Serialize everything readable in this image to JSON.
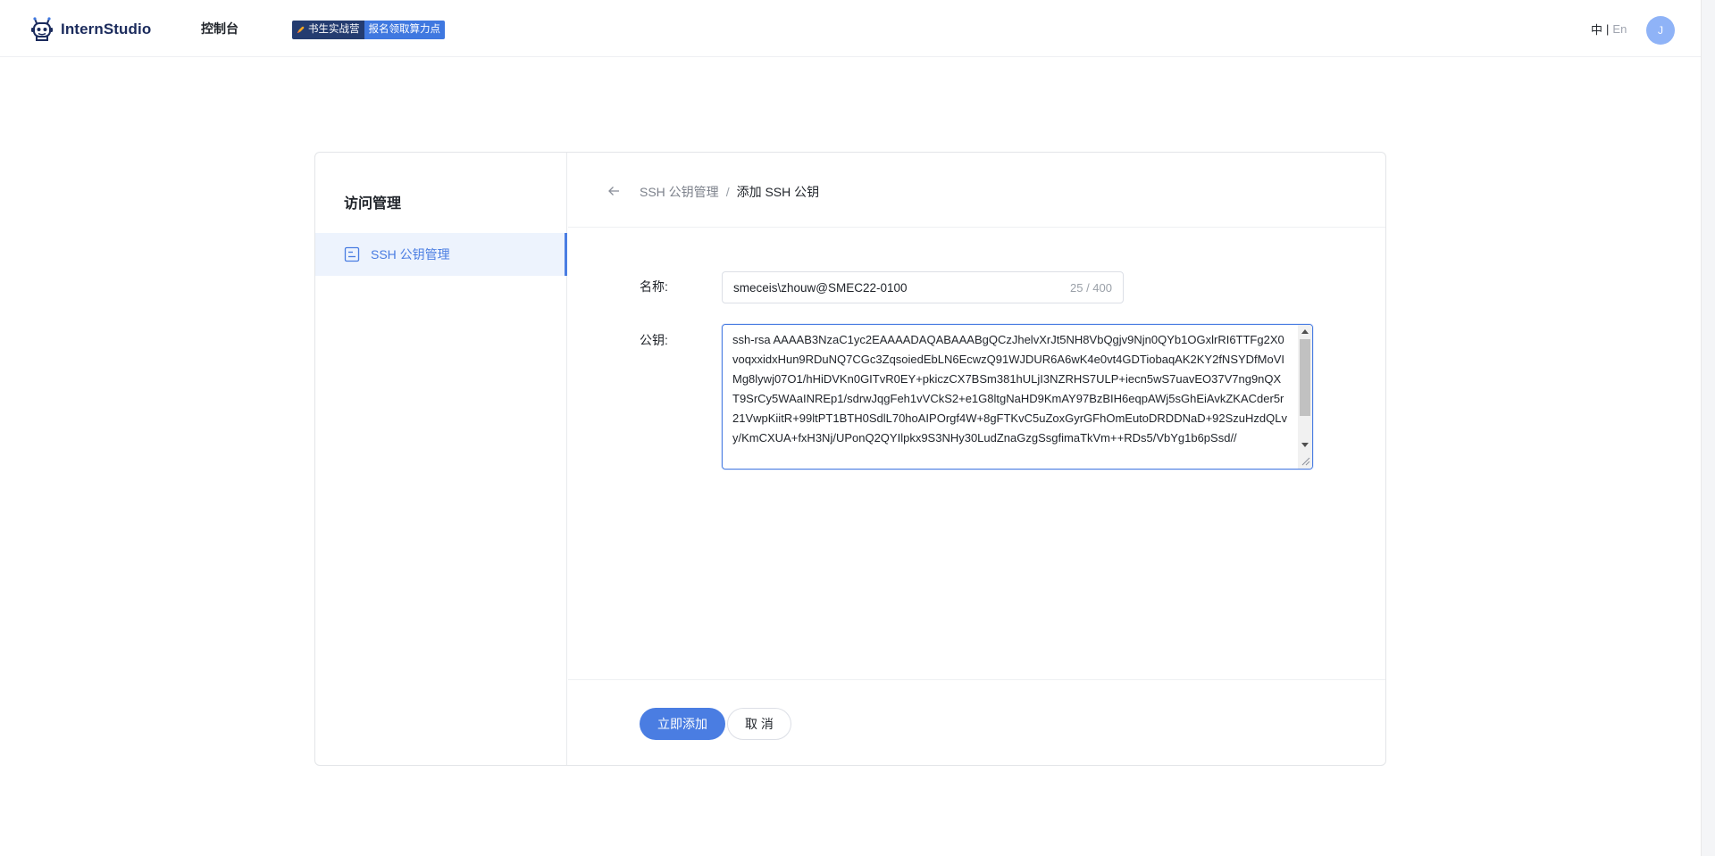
{
  "header": {
    "logo_text": "InternStudio",
    "logo_icon": "robot-logo-icon",
    "nav_console": "控制台",
    "promo": {
      "icon": "rocket-icon",
      "left_label": "书生实战营",
      "right_label": "报名领取算力点"
    },
    "lang": {
      "zh": "中",
      "separator": "|",
      "en": "En"
    },
    "avatar_initial": "J"
  },
  "sidebar": {
    "title": "访问管理",
    "items": [
      {
        "label": "SSH 公钥管理",
        "icon": "document-icon",
        "active": true
      }
    ]
  },
  "breadcrumb": {
    "back_icon": "arrow-left-icon",
    "parent": "SSH 公钥管理",
    "separator": "/",
    "current": "添加 SSH 公钥"
  },
  "form": {
    "name_label": "名称:",
    "name_value": "smeceis\\zhouw@SMEC22-0100",
    "name_count": "25 / 400",
    "key_label": "公钥:",
    "key_value": "ssh-rsa AAAAB3NzaC1yc2EAAAADAQABAAABgQCzJhelvXrJt5NH8VbQgjv9Njn0QYb1OGxlrRI6TTFg2X0voqxxidxHun9RDuNQ7CGc3ZqsoiedEbLN6EcwzQ91WJDUR6A6wK4e0vt4GDTiobaqAK2KY2fNSYDfMoVIMg8lywj07O1/hHiDVKn0GITvR0EY+pkiczCX7BSm381hULjI3NZRHS7ULP+iecn5wS7uavEO37V7ng9nQXT9SrCy5WAaINREp1/sdrwJqgFeh1vVCkS2+e1G8ltgNaHD9KmAY97BzBIH6eqpAWj5sGhEiAvkZKACder5r21VwpKiitR+99ltPT1BTH0SdlL70hoAIPOrgf4W+8gFTKvC5uZoxGyrGFhOmEutoDRDDNaD+92SzuHzdQLvy/KmCXUA+fxH3Nj/UPonQ2QYIlpkx9S3NHy30LudZnaGzgSsgfimaTkVm++RDs5/VbYg1b6pSsd//"
  },
  "actions": {
    "submit_label": "立即添加",
    "cancel_label": "取 消"
  },
  "colors": {
    "accent": "#4a7de2",
    "active_bg": "#edf3fd",
    "promo_dark": "#243c70",
    "promo_blue": "#3f78e0",
    "avatar": "#8fb3f7"
  }
}
